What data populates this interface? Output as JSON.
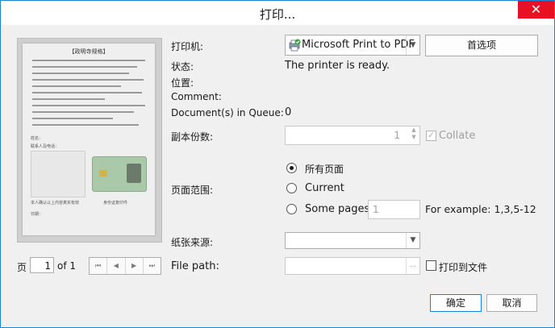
{
  "window": {
    "title": "打印...",
    "close_glyph": "✕"
  },
  "preview": {
    "doc_title": "【政明寺规格】",
    "doc_field1": "姓名：",
    "doc_field2": "联系人及电话：",
    "doc_footer1": "本人确认以上内容真实有效",
    "doc_footer2": "身份证复印件",
    "doc_date": "日期："
  },
  "pager": {
    "page_label": "页",
    "page_value": "1",
    "of_label": "of 1",
    "nav": [
      "⏮",
      "◀",
      "▶",
      "⏭"
    ]
  },
  "printer": {
    "label": "打印机:",
    "selected": "Microsoft Print to PDF",
    "preferences_button": "首选项"
  },
  "status": {
    "label": "状态:",
    "value": "The printer is ready."
  },
  "location": {
    "label": "位置:",
    "value": ""
  },
  "comment": {
    "label": "Comment:",
    "value": ""
  },
  "queue": {
    "label": "Document(s) in Queue:",
    "value": "0"
  },
  "copies": {
    "label": "副本份数:",
    "value": "1",
    "collate_label": "Collate",
    "collate_checked": true
  },
  "page_range": {
    "label": "页面范围:",
    "options": [
      "所有页面",
      "Current",
      "Some pages"
    ],
    "selected_index": 0,
    "some_pages_placeholder": "1",
    "example": "For example: 1,3,5-12"
  },
  "paper_source": {
    "label": "纸张来源:",
    "value": ""
  },
  "file_path": {
    "label": "File path:",
    "value": "",
    "browse_glyph": "...",
    "print_to_file_label": "打印到文件"
  },
  "buttons": {
    "ok": "确定",
    "cancel": "取消"
  },
  "colors": {
    "accent": "#1883d7",
    "close": "#e81123"
  }
}
